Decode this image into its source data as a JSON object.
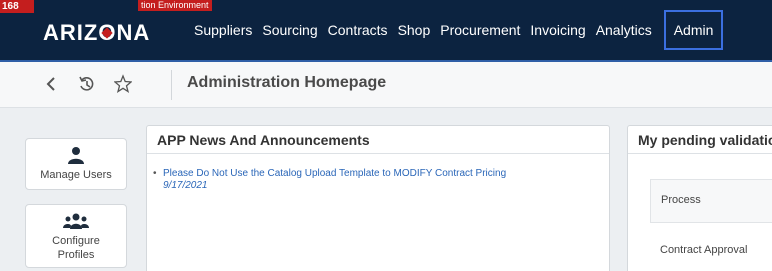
{
  "env": {
    "badge": "168",
    "label": "tion Environment"
  },
  "brand": {
    "logo_text_a": "ARIZ",
    "logo_text_o": "O",
    "logo_text_b": "NA"
  },
  "nav": {
    "items": [
      {
        "label": "Suppliers"
      },
      {
        "label": "Sourcing"
      },
      {
        "label": "Contracts"
      },
      {
        "label": "Shop"
      },
      {
        "label": "Procurement"
      },
      {
        "label": "Invoicing"
      },
      {
        "label": "Analytics"
      },
      {
        "label": "Admin",
        "active": true
      }
    ]
  },
  "toolbar": {
    "back_icon": "chevron-left-icon",
    "history_icon": "history-icon",
    "favorite_icon": "star-icon"
  },
  "page": {
    "title": "Administration Homepage"
  },
  "tiles": [
    {
      "label": "Manage Users",
      "icon": "user-icon"
    },
    {
      "label_line1": "Configure",
      "label_line2": "Profiles",
      "icon": "users-group-icon"
    }
  ],
  "news_panel": {
    "title": "APP News And Announcements",
    "items": [
      {
        "text": "Please Do Not Use the Catalog Upload Template to MODIFY Contract Pricing",
        "date": "9/17/2021"
      }
    ]
  },
  "pending_panel": {
    "title": "My pending validatio",
    "column_header": "Process",
    "rows": [
      {
        "process": "Contract Approval"
      }
    ]
  },
  "colors": {
    "nav_bg": "#0c2340",
    "accent": "#3b6fe0",
    "badge_red": "#c41e1e",
    "link_blue": "#2a66b8"
  }
}
